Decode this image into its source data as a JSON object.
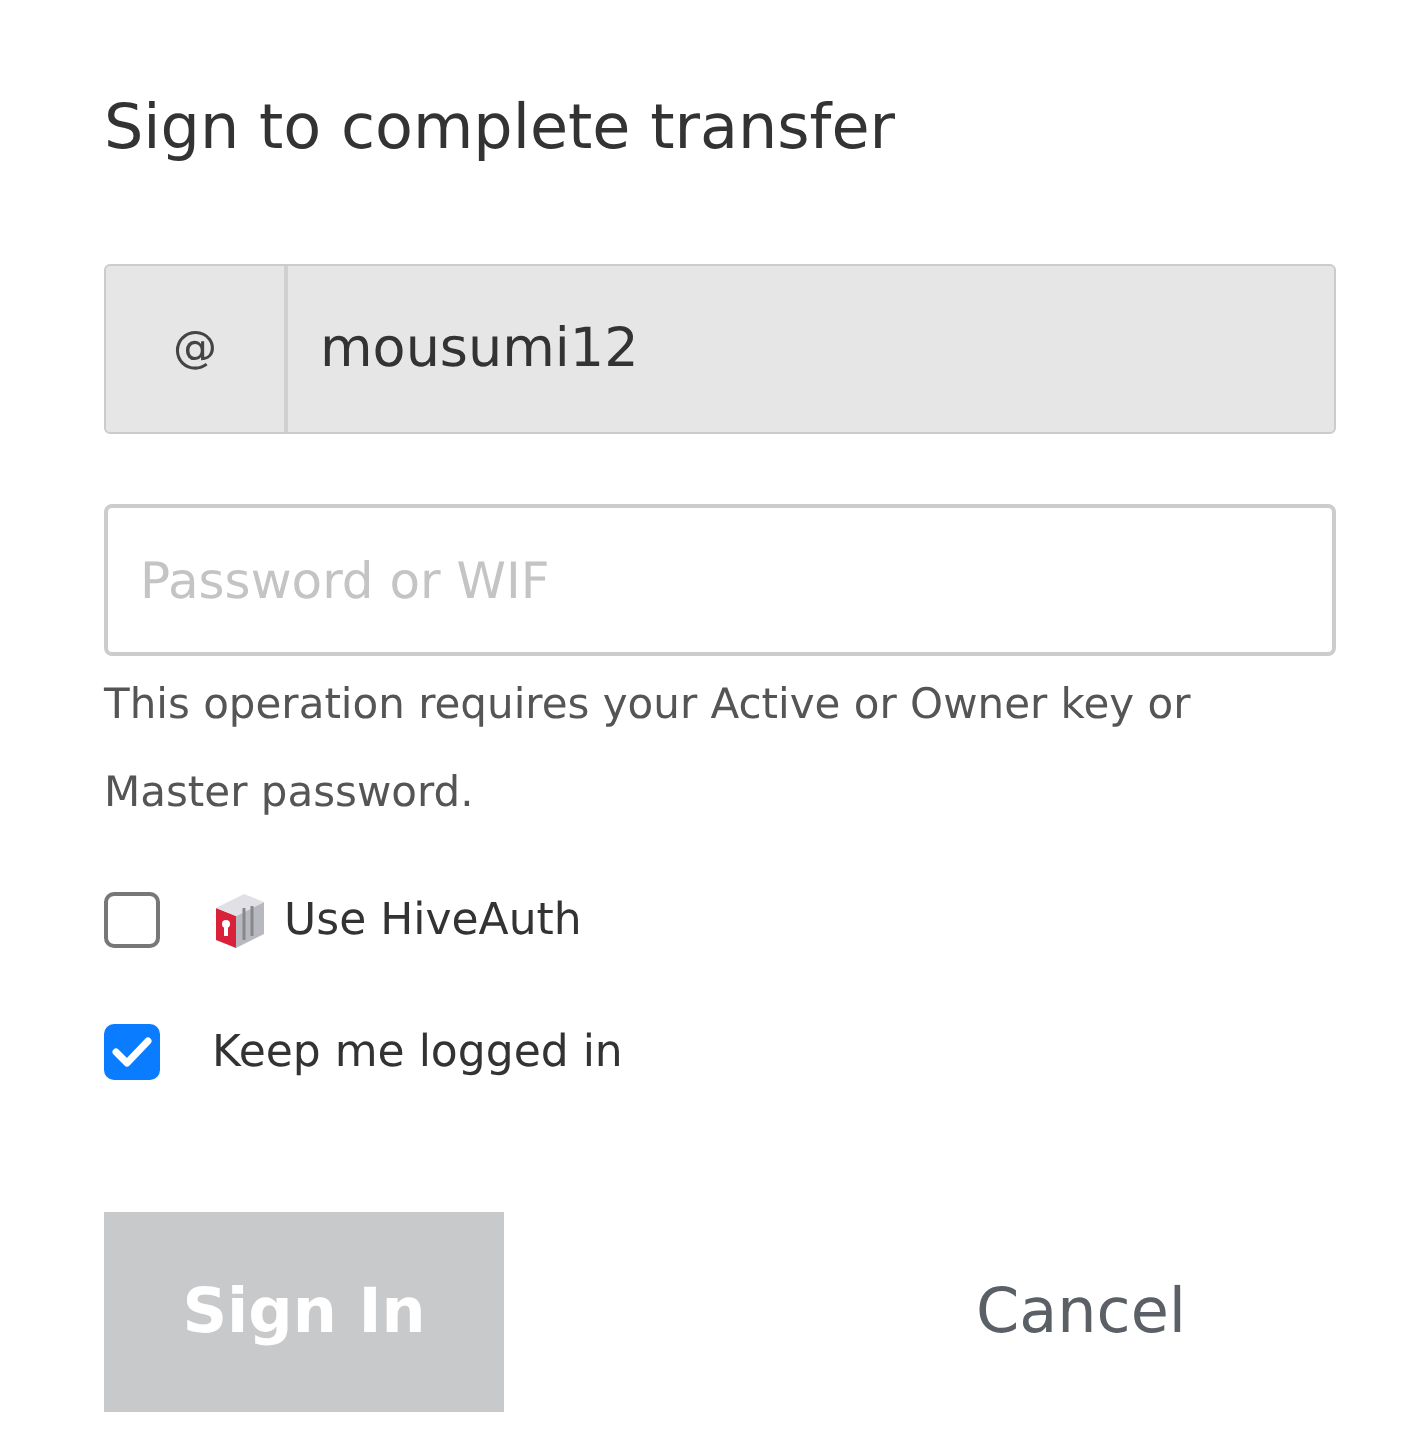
{
  "dialog": {
    "title": "Sign to complete transfer"
  },
  "username": {
    "prefix": "@",
    "value": "mousumi12"
  },
  "password": {
    "placeholder": "Password or WIF"
  },
  "help_text": "This operation requires your Active or Owner key or Master password.",
  "options": [
    {
      "kind": "app-icon",
      "label": "Use HiveAuth",
      "checked": false
    },
    {
      "kind": "plain",
      "label": "Keep me logged in",
      "checked": true
    }
  ],
  "buttons": [
    {
      "kind": "primary",
      "label": "Sign In",
      "disabled": true
    },
    {
      "kind": "link",
      "label": "Cancel",
      "disabled": false
    }
  ]
}
